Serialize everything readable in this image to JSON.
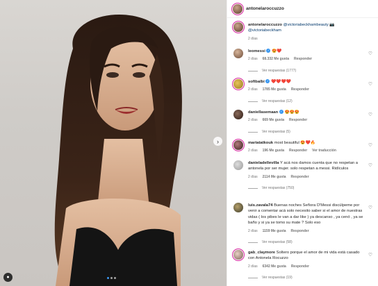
{
  "post": {
    "photo_indicator_count": 3,
    "photo_indicator_active": 1
  },
  "header": {
    "username": "antonelaroccuzzo"
  },
  "caption": {
    "username": "antonelaroccuzzo",
    "mention1": "@victoriabeckhambeauty",
    "mention2": "@victoriabeckham",
    "time": "2 días"
  },
  "comments": [
    {
      "user": "leomessi",
      "verified": true,
      "text": "😍❤️",
      "time": "2 días",
      "likes": "68.332 Me gusta",
      "reply": "Responder",
      "replies": "Ver respuestas (1777)"
    },
    {
      "user": "sofibalbi",
      "verified": true,
      "text": "❤️❤️❤️❤️",
      "time": "2 días",
      "likes": "1785 Me gusta",
      "reply": "Responder",
      "replies": "Ver respuestas (12)"
    },
    {
      "user": "daniellasemaan",
      "verified": true,
      "text": "😍😍😍",
      "time": "2 días",
      "likes": "669 Me gusta",
      "reply": "Responder",
      "replies": "Ver respuestas (5)"
    },
    {
      "user": "mariatatkouk",
      "verified": false,
      "text": "most beautiful 😍❤️🔥",
      "time": "2 días",
      "likes": "196 Me gusta",
      "reply": "Responder",
      "translate": "Ver traducción"
    },
    {
      "user": "danieladellevilla",
      "verified": false,
      "text": "Y acá nos damos cuenta que no respetan a antonela por ser mujer. solo respetan a messi. Ridículos",
      "time": "2 días",
      "likes": "2114 Me gusta",
      "reply": "Responder",
      "replies": "Ver respuestas (750)"
    },
    {
      "user": "luis.zavala74",
      "verified": false,
      "text": "Buenas noches Señora D'Messi discúlpeme por venir a comentar acá solo necesito saber si el amor de nuestras vidas ( los pibes le van a dar like ) ya descanso , ya cenó , ya se baño y si ya se tomo su mate ? Solo eso",
      "time": "2 días",
      "likes": "1159 Me gusta",
      "reply": "Responder",
      "replies": "Ver respuestas (58)"
    },
    {
      "user": "gab_claymore",
      "verified": false,
      "text": "Soltero porque el amor de mi vida está casado con Antonela Rocuzzo",
      "time": "2 días",
      "likes": "6342 Me gusta",
      "reply": "Responder",
      "replies": "Ver respuestas (19)"
    }
  ]
}
